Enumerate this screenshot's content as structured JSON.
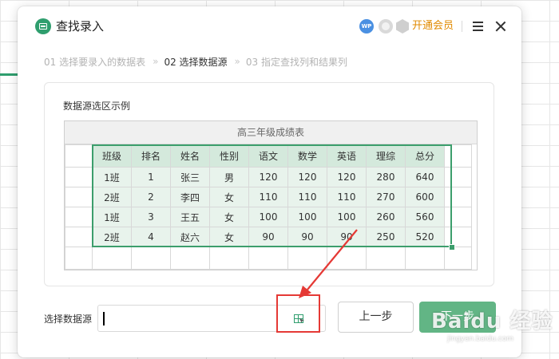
{
  "dialog": {
    "title": "查找录入",
    "wps_badge": "WP",
    "vip_link": "开通会员"
  },
  "steps": [
    {
      "label": "01 选择要录入的数据表",
      "active": false
    },
    {
      "label": "02 选择数据源",
      "active": true
    },
    {
      "label": "03 指定查找列和结果列",
      "active": false
    }
  ],
  "step_separator": "»",
  "preview": {
    "label": "数据源选区示例",
    "table_title": "高三年级成绩表",
    "headers": [
      "班级",
      "排名",
      "姓名",
      "性别",
      "语文",
      "数学",
      "英语",
      "理综",
      "总分"
    ],
    "rows": [
      [
        "1班",
        "1",
        "张三",
        "男",
        "120",
        "120",
        "120",
        "280",
        "640"
      ],
      [
        "2班",
        "2",
        "李四",
        "女",
        "110",
        "110",
        "110",
        "270",
        "600"
      ],
      [
        "1班",
        "3",
        "王五",
        "女",
        "100",
        "100",
        "100",
        "260",
        "560"
      ],
      [
        "2班",
        "4",
        "赵六",
        "女",
        "90",
        "90",
        "90",
        "250",
        "520"
      ]
    ]
  },
  "source": {
    "label": "选择数据源",
    "value": "",
    "placeholder": ""
  },
  "buttons": {
    "prev": "上一步",
    "next": "下一步"
  },
  "watermark": {
    "main": "Baidu 经验",
    "sub": "jingyan.baidu.com"
  },
  "colors": {
    "accent": "#2f9e6e",
    "next_button": "#62b585",
    "vip": "#e08a00",
    "highlight": "#e53935"
  }
}
